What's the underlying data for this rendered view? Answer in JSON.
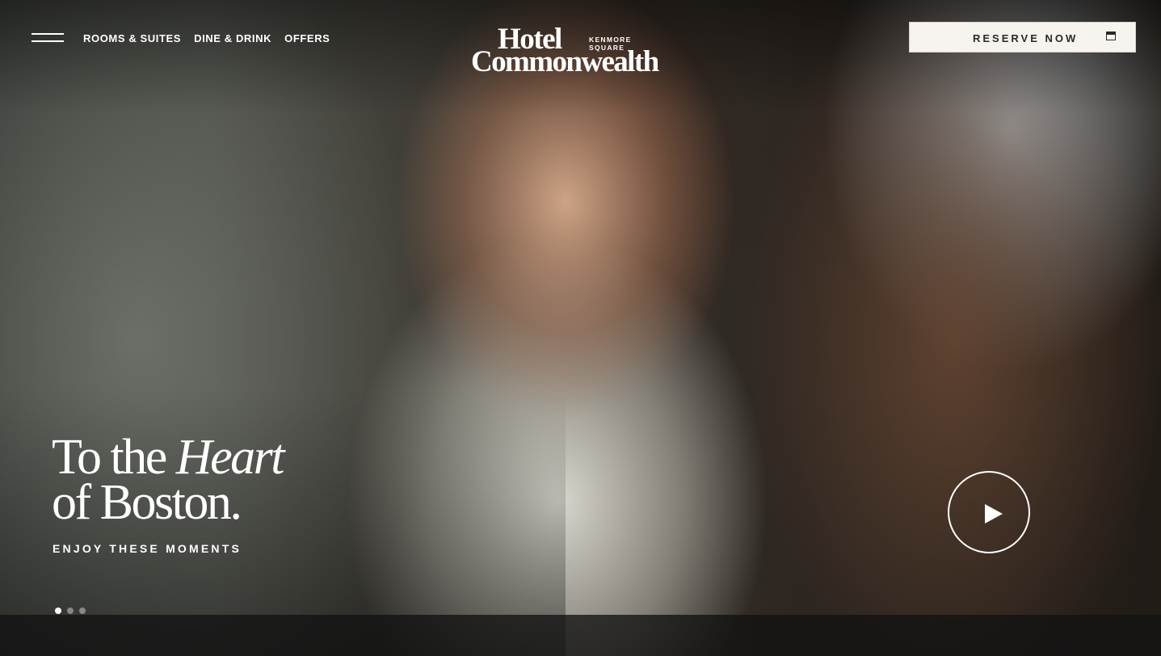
{
  "header": {
    "nav": [
      {
        "label": "ROOMS & SUITES"
      },
      {
        "label": "DINE & DRINK"
      },
      {
        "label": "OFFERS"
      }
    ],
    "logo": {
      "line1": "Hotel",
      "line2": "Commonwealth",
      "sub1": "KENMORE",
      "sub2": "SQUARE"
    },
    "reserve_label": "RESERVE NOW"
  },
  "hero": {
    "headline_part1": "To the ",
    "headline_italic": "Heart",
    "headline_line2": "of Boston.",
    "tagline": "ENJOY THESE MOMENTS",
    "slides_total": 3,
    "active_slide": 1
  },
  "icons": {
    "menu": "hamburger-menu-icon",
    "calendar": "calendar-icon",
    "play": "play-icon"
  }
}
